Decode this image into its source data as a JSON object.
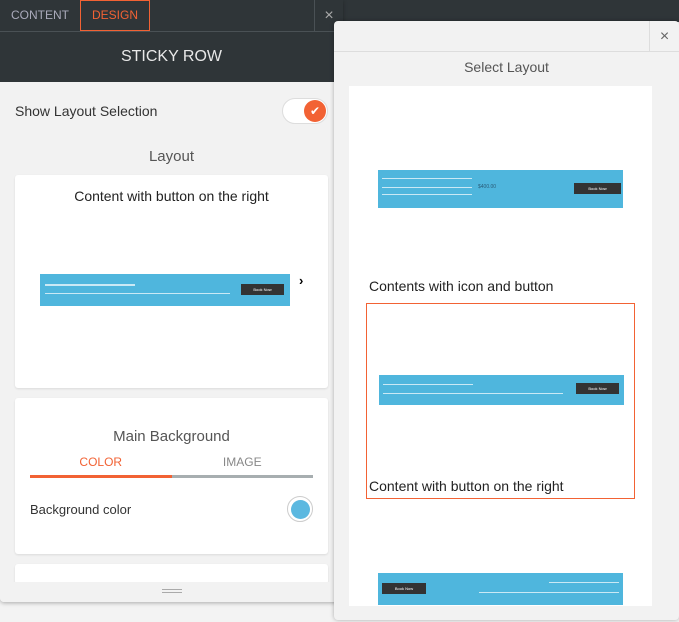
{
  "left_panel": {
    "tabs": [
      {
        "label": "CONTENT"
      },
      {
        "label": "DESIGN",
        "active": true
      }
    ],
    "close_icon": "×",
    "title": "STICKY ROW",
    "show_layout_label": "Show Layout Selection",
    "show_layout_on": true,
    "layout_heading": "Layout",
    "current_layout": "Content with button on the right",
    "thumb_button": "Book Now",
    "main_background": {
      "heading": "Main Background",
      "tabs": [
        "COLOR",
        "IMAGE"
      ],
      "active_tab": "COLOR",
      "bg_color_label": "Background color",
      "bg_color": "#5bb8e0"
    }
  },
  "right_panel": {
    "close_icon": "×",
    "title": "Select Layout",
    "layouts": [
      {
        "label": "Contents with icon and button",
        "price": "$400.00",
        "button": "Book Now"
      },
      {
        "label": "Content with button on the right",
        "selected": true,
        "button": "Book Now"
      },
      {
        "button": "Book Now"
      }
    ]
  },
  "colors": {
    "accent": "#f26234",
    "header": "#2f3538",
    "thumb": "#4fb6dd"
  }
}
